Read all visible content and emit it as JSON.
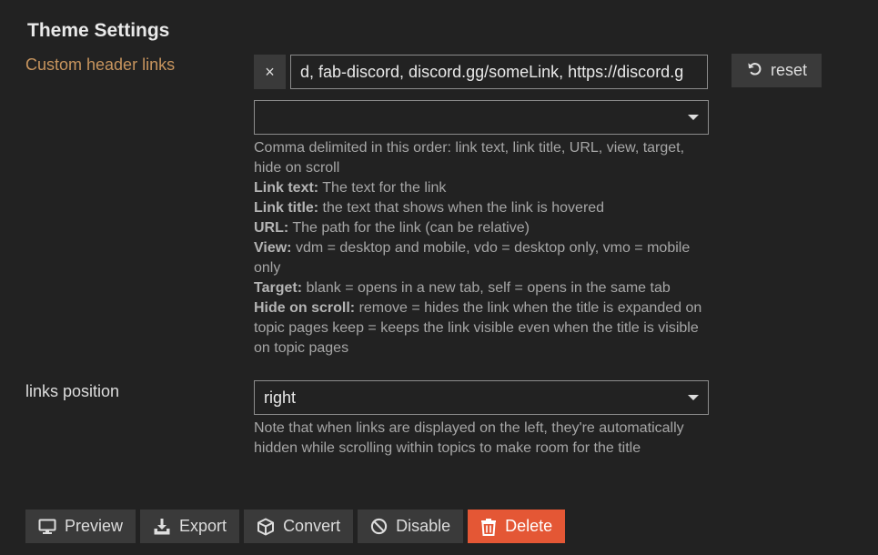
{
  "page_title": "Theme Settings",
  "custom_header_links": {
    "label": "Custom header links",
    "remove_glyph": "×",
    "value": "d, fab-discord, discord.gg/someLink, https://discord.g",
    "add_select_value": "",
    "reset_label": "reset",
    "help": {
      "intro": "Comma delimited in this order: link text, link title, URL, view, target, hide on scroll",
      "link_text_label": "Link text:",
      "link_text_desc": " The text for the link",
      "link_title_label": "Link title:",
      "link_title_desc": " the text that shows when the link is hovered",
      "url_label": "URL:",
      "url_desc": " The path for the link (can be relative)",
      "view_label": "View:",
      "view_desc": " vdm = desktop and mobile, vdo = desktop only, vmo = mobile only",
      "target_label": "Target:",
      "target_desc": " blank = opens in a new tab, self = opens in the same tab",
      "hide_label": "Hide on scroll:",
      "hide_desc": " remove = hides the link when the title is expanded on topic pages keep = keeps the link visible even when the title is visible on topic pages"
    }
  },
  "links_position": {
    "label": "links position",
    "value": "right",
    "help": "Note that when links are displayed on the left, they're automatically hidden while scrolling within topics to make room for the title"
  },
  "footer": {
    "preview": "Preview",
    "export": "Export",
    "convert": "Convert",
    "disable": "Disable",
    "delete": "Delete"
  },
  "colors": {
    "background": "#222222",
    "accent_label": "#c8955e",
    "delete_button": "#e45735"
  }
}
